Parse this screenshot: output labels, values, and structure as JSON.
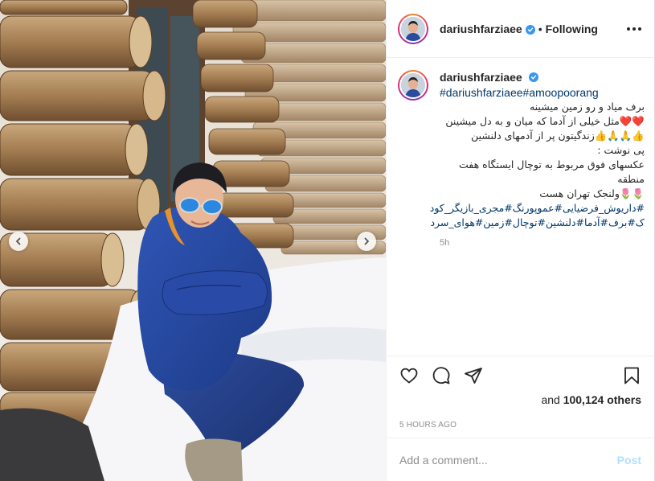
{
  "post": {
    "username": "dariushfarziaee",
    "separator": "•",
    "following_label": "Following",
    "caption": {
      "username": "dariushfarziaee",
      "hashtags_latin": "#dariushfarziaee#amoopoorang",
      "lines": [
        "برف میاد و رو زمین میشینه",
        "❤️❤️مثل خیلی از آدما که میان و به دل میشینن",
        "👍🙏🙏👍زندگیتون پر از آدمهای دلنشین",
        "پی نوشت :",
        "عکسهای فوق مربوط به توچال ایستگاه هفت منطقه",
        "🌷🌷ولنجک تهران هست"
      ],
      "tag_lines": [
        "#داریوش_فرضیایی#عموپورنگ#مجری_بازیگر_کود",
        "ک#برف#آدما#دلنشین#توچال#زمین#هوای_سرد"
      ],
      "time": "5h"
    },
    "likes_prefix": "and",
    "likes_count": "100,124",
    "likes_suffix": "others",
    "date": "5 HOURS AGO",
    "comment_placeholder": "Add a comment...",
    "post_label": "Post"
  },
  "icons": {
    "verified": "verified-badge-icon",
    "more": "more-options-icon",
    "like": "heart-icon",
    "comment": "comment-icon",
    "share": "paper-plane-icon",
    "save": "bookmark-icon",
    "prev": "chevron-left-icon",
    "next": "chevron-right-icon"
  },
  "colors": {
    "verified_blue": "#3897f0",
    "hashtag_blue": "#00376b",
    "muted_gray": "#8e8e8e",
    "post_disabled": "#b2dffc"
  }
}
